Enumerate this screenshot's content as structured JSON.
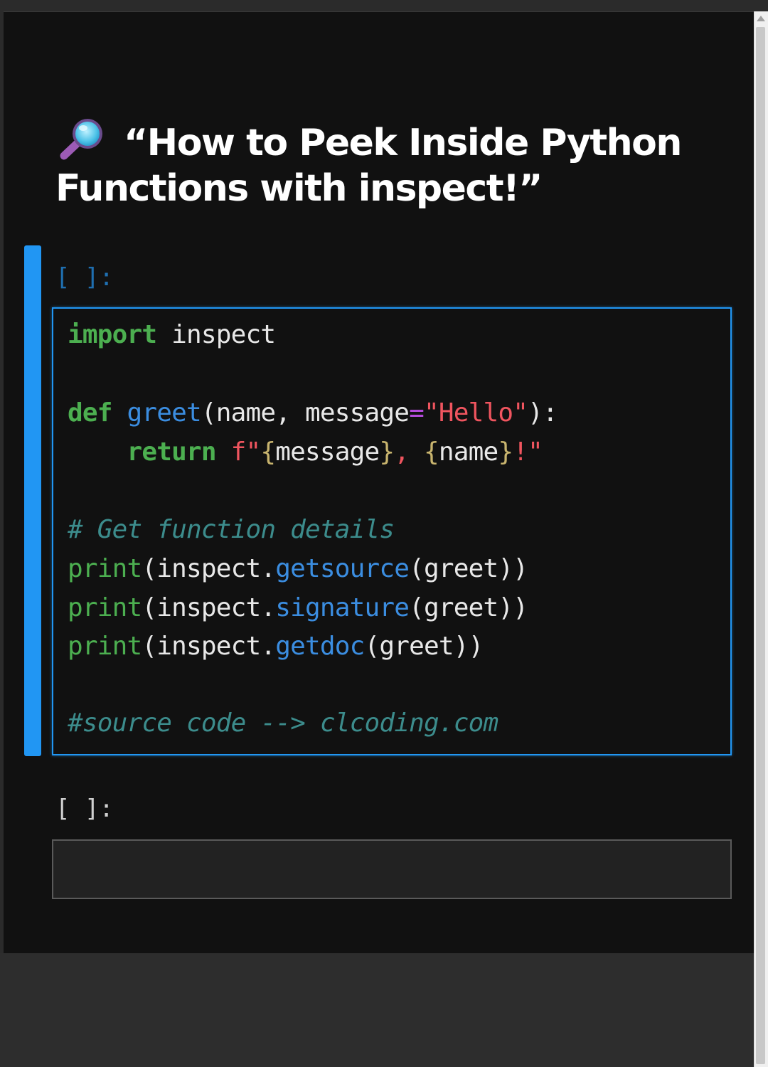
{
  "title": {
    "icon": "magnifying-glass-icon",
    "text": "“How to Peek Inside Python Functions with inspect!”"
  },
  "cells": [
    {
      "prompt": "[ ]:",
      "active": true,
      "code": {
        "line1": {
          "kw": "import",
          "rest": " inspect"
        },
        "line3": {
          "kw": "def",
          "sp": " ",
          "fn": "greet",
          "params": "(name, message",
          "eq": "=",
          "default": "\"Hello\"",
          "end": "):"
        },
        "line4": {
          "indent": "    ",
          "kw": "return",
          "sp": " ",
          "fprefix": "f\"",
          "b1": "{",
          "v1": "message",
          "b2": "}",
          "mid": ", ",
          "b3": "{",
          "v2": "name",
          "b4": "}",
          "tail": "!\""
        },
        "line6": {
          "comment": "# Get function details"
        },
        "line7": {
          "bi": "print",
          "pre": "(inspect.",
          "fn": "getsource",
          "post": "(greet))"
        },
        "line8": {
          "bi": "print",
          "pre": "(inspect.",
          "fn": "signature",
          "post": "(greet))"
        },
        "line9": {
          "bi": "print",
          "pre": "(inspect.",
          "fn": "getdoc",
          "post": "(greet))"
        },
        "line11": {
          "comment": "#source code --> clcoding.com"
        }
      }
    },
    {
      "prompt": "[ ]:",
      "active": false,
      "code": ""
    }
  ],
  "colors": {
    "background": "#111111",
    "accent": "#2196f3",
    "keyword": "#4caf50",
    "function": "#3b8de0",
    "string": "#f0555f",
    "comment": "#3c8c8c"
  }
}
